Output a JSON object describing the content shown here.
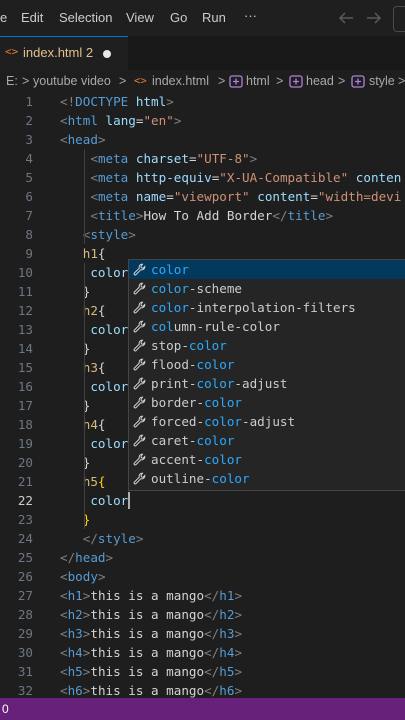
{
  "menubar": {
    "items": [
      "e",
      "Edit",
      "Selection",
      "View",
      "Go",
      "Run",
      "···"
    ],
    "back_icon": "arrow-left-icon",
    "forward_icon": "arrow-right-icon"
  },
  "tab": {
    "icon": "html-file-icon",
    "icon_glyph": "<>",
    "label": "index.html 2",
    "dirty_icon": "dot-icon"
  },
  "breadcrumb": {
    "items": [
      "E:",
      "youtube video",
      "index.html",
      "html",
      "head",
      "style"
    ],
    "separator": ">"
  },
  "editor": {
    "lines": [
      {
        "n": "1",
        "parts": [
          [
            "t",
            "<!"
          ],
          [
            "tg",
            "DOCTYPE"
          ],
          [
            "tx",
            " "
          ],
          [
            "at",
            "html"
          ],
          [
            "t",
            ">"
          ]
        ]
      },
      {
        "n": "2",
        "parts": [
          [
            "t",
            "<"
          ],
          [
            "tg",
            "html"
          ],
          [
            "tx",
            " "
          ],
          [
            "at",
            "lang"
          ],
          [
            "tx",
            "="
          ],
          [
            "st",
            "\"en\""
          ],
          [
            "t",
            ">"
          ]
        ]
      },
      {
        "n": "3",
        "parts": [
          [
            "t",
            "<"
          ],
          [
            "tg",
            "head"
          ],
          [
            "t",
            ">"
          ]
        ]
      },
      {
        "n": "4",
        "parts": [
          [
            "tx",
            "    "
          ],
          [
            "t",
            "<"
          ],
          [
            "tg",
            "meta"
          ],
          [
            "tx",
            " "
          ],
          [
            "at",
            "charset"
          ],
          [
            "tx",
            "="
          ],
          [
            "st",
            "\"UTF-8\""
          ],
          [
            "t",
            ">"
          ]
        ]
      },
      {
        "n": "5",
        "parts": [
          [
            "tx",
            "    "
          ],
          [
            "t",
            "<"
          ],
          [
            "tg",
            "meta"
          ],
          [
            "tx",
            " "
          ],
          [
            "at",
            "http-equiv"
          ],
          [
            "tx",
            "="
          ],
          [
            "st",
            "\"X-UA-Compatible\""
          ],
          [
            "tx",
            " "
          ],
          [
            "at",
            "conten"
          ]
        ]
      },
      {
        "n": "6",
        "parts": [
          [
            "tx",
            "    "
          ],
          [
            "t",
            "<"
          ],
          [
            "tg",
            "meta"
          ],
          [
            "tx",
            " "
          ],
          [
            "at",
            "name"
          ],
          [
            "tx",
            "="
          ],
          [
            "st",
            "\"viewport\""
          ],
          [
            "tx",
            " "
          ],
          [
            "at",
            "content"
          ],
          [
            "tx",
            "="
          ],
          [
            "st",
            "\"width=devi"
          ]
        ]
      },
      {
        "n": "7",
        "parts": [
          [
            "tx",
            "    "
          ],
          [
            "t",
            "<"
          ],
          [
            "tg",
            "title"
          ],
          [
            "t",
            ">"
          ],
          [
            "tx",
            "How To Add Border"
          ],
          [
            "t",
            "</"
          ],
          [
            "tg",
            "title"
          ],
          [
            "t",
            ">"
          ]
        ]
      },
      {
        "n": "8",
        "parts": [
          [
            "tx",
            "   "
          ],
          [
            "t",
            "<"
          ],
          [
            "tg",
            "style"
          ],
          [
            "t",
            ">"
          ]
        ]
      },
      {
        "n": "9",
        "parts": [
          [
            "tx",
            "   "
          ],
          [
            "sel",
            "h1"
          ],
          [
            "tx",
            "{"
          ]
        ]
      },
      {
        "n": "10",
        "parts": [
          [
            "tx",
            "    "
          ],
          [
            "pr",
            "color"
          ]
        ]
      },
      {
        "n": "11",
        "parts": [
          [
            "tx",
            "   "
          ],
          [
            "tx",
            "}"
          ]
        ]
      },
      {
        "n": "12",
        "parts": [
          [
            "tx",
            "   "
          ],
          [
            "sel",
            "h2"
          ],
          [
            "tx",
            "{"
          ]
        ]
      },
      {
        "n": "13",
        "parts": [
          [
            "tx",
            "    "
          ],
          [
            "pr",
            "color"
          ]
        ]
      },
      {
        "n": "14",
        "parts": [
          [
            "tx",
            "   "
          ],
          [
            "tx",
            "}"
          ]
        ]
      },
      {
        "n": "15",
        "parts": [
          [
            "tx",
            "   "
          ],
          [
            "sel",
            "h3"
          ],
          [
            "tx",
            "{"
          ]
        ]
      },
      {
        "n": "16",
        "parts": [
          [
            "tx",
            "    "
          ],
          [
            "pr",
            "color"
          ]
        ]
      },
      {
        "n": "17",
        "parts": [
          [
            "tx",
            "   "
          ],
          [
            "tx",
            "}"
          ]
        ]
      },
      {
        "n": "18",
        "parts": [
          [
            "tx",
            "   "
          ],
          [
            "sel",
            "h4"
          ],
          [
            "tx",
            "{"
          ]
        ]
      },
      {
        "n": "19",
        "parts": [
          [
            "tx",
            "    "
          ],
          [
            "pr",
            "color"
          ]
        ]
      },
      {
        "n": "20",
        "parts": [
          [
            "tx",
            "   "
          ],
          [
            "tx",
            "}"
          ]
        ]
      },
      {
        "n": "21",
        "parts": [
          [
            "tx",
            "   "
          ],
          [
            "sel",
            "h5"
          ],
          [
            "br",
            "{"
          ]
        ]
      },
      {
        "n": "22",
        "parts": [
          [
            "tx",
            "    "
          ],
          [
            "pr",
            "color"
          ]
        ],
        "active": true
      },
      {
        "n": "23",
        "parts": [
          [
            "tx",
            "   "
          ],
          [
            "br",
            "}"
          ]
        ]
      },
      {
        "n": "24",
        "parts": [
          [
            "tx",
            "   "
          ],
          [
            "t",
            "</"
          ],
          [
            "tg",
            "style"
          ],
          [
            "t",
            ">"
          ]
        ]
      },
      {
        "n": "25",
        "parts": [
          [
            "t",
            "</"
          ],
          [
            "tg",
            "head"
          ],
          [
            "t",
            ">"
          ]
        ]
      },
      {
        "n": "26",
        "parts": [
          [
            "t",
            "<"
          ],
          [
            "tg",
            "body"
          ],
          [
            "t",
            ">"
          ]
        ]
      },
      {
        "n": "27",
        "parts": [
          [
            "t",
            "<"
          ],
          [
            "tg",
            "h1"
          ],
          [
            "t",
            ">"
          ],
          [
            "tx",
            "this is a mango"
          ],
          [
            "t",
            "</"
          ],
          [
            "tg",
            "h1"
          ],
          [
            "t",
            ">"
          ]
        ]
      },
      {
        "n": "28",
        "parts": [
          [
            "t",
            "<"
          ],
          [
            "tg",
            "h2"
          ],
          [
            "t",
            ">"
          ],
          [
            "tx",
            "this is a mango"
          ],
          [
            "t",
            "</"
          ],
          [
            "tg",
            "h2"
          ],
          [
            "t",
            ">"
          ]
        ]
      },
      {
        "n": "29",
        "parts": [
          [
            "t",
            "<"
          ],
          [
            "tg",
            "h3"
          ],
          [
            "t",
            ">"
          ],
          [
            "tx",
            "this is a mango"
          ],
          [
            "t",
            "</"
          ],
          [
            "tg",
            "h3"
          ],
          [
            "t",
            ">"
          ]
        ]
      },
      {
        "n": "30",
        "parts": [
          [
            "t",
            "<"
          ],
          [
            "tg",
            "h4"
          ],
          [
            "t",
            ">"
          ],
          [
            "tx",
            "this is a mango"
          ],
          [
            "t",
            "</"
          ],
          [
            "tg",
            "h4"
          ],
          [
            "t",
            ">"
          ]
        ]
      },
      {
        "n": "31",
        "parts": [
          [
            "t",
            "<"
          ],
          [
            "tg",
            "h5"
          ],
          [
            "t",
            ">"
          ],
          [
            "tx",
            "this is a mango"
          ],
          [
            "t",
            "</"
          ],
          [
            "tg",
            "h5"
          ],
          [
            "t",
            ">"
          ]
        ]
      },
      {
        "n": "32",
        "parts": [
          [
            "t",
            "<"
          ],
          [
            "tg",
            "h6"
          ],
          [
            "t",
            ">"
          ],
          [
            "tx",
            "this is a mango"
          ],
          [
            "t",
            "</"
          ],
          [
            "tg",
            "h6"
          ],
          [
            "t",
            ">"
          ]
        ]
      }
    ]
  },
  "suggestions": {
    "icon": "wrench-icon",
    "items": [
      {
        "pre": "",
        "match": "color",
        "post": ""
      },
      {
        "pre": "",
        "match": "color",
        "post": "-scheme"
      },
      {
        "pre": "",
        "match": "color",
        "post": "-interpolation-filters"
      },
      {
        "pre": "",
        "match": "col",
        "post": "umn-rule-color"
      },
      {
        "pre": "stop-",
        "match": "color",
        "post": ""
      },
      {
        "pre": "flood-",
        "match": "color",
        "post": ""
      },
      {
        "pre": "print-",
        "match": "color",
        "post": "-adjust"
      },
      {
        "pre": "border-",
        "match": "color",
        "post": ""
      },
      {
        "pre": "forced-",
        "match": "color",
        "post": "-adjust"
      },
      {
        "pre": "caret-",
        "match": "color",
        "post": ""
      },
      {
        "pre": "accent-",
        "match": "color",
        "post": ""
      },
      {
        "pre": "outline-",
        "match": "color",
        "post": ""
      }
    ],
    "selected_index": 0
  },
  "statusbar": {
    "left_text": "0"
  },
  "colors": {
    "accent": "#0078d4",
    "statusbar": "#68217a",
    "match_highlight": "#2aaaff"
  }
}
